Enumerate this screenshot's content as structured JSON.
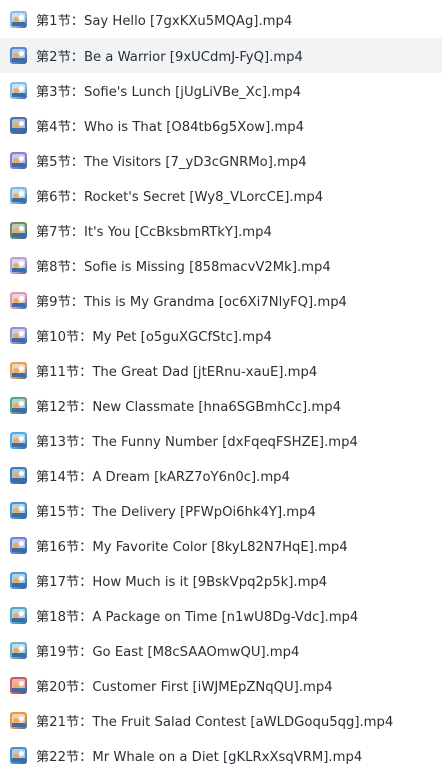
{
  "file_list": {
    "selected_index": 1,
    "items": [
      {
        "name": "第1节：Say Hello [7gxKXu5MQAg].mp4",
        "icon": "video-thumbnail-icon",
        "color": "#8fb7e6"
      },
      {
        "name": "第2节：Be a Warrior [9xUCdmJ-FyQ].mp4",
        "icon": "video-thumbnail-icon",
        "color": "#5f86c9"
      },
      {
        "name": "第3节：Sofie's Lunch [jUgLiVBe_Xc].mp4",
        "icon": "video-thumbnail-icon",
        "color": "#7ec0e8"
      },
      {
        "name": "第4节：Who is That [O84tb6g5Xow].mp4",
        "icon": "video-thumbnail-icon",
        "color": "#4f6fa8"
      },
      {
        "name": "第5节：The Visitors [7_yD3cGNRMo].mp4",
        "icon": "video-thumbnail-icon",
        "color": "#8a7fd6"
      },
      {
        "name": "第6节：Rocket's  Secret [Wy8_VLorcCE].mp4",
        "icon": "video-thumbnail-icon",
        "color": "#7fb6d8"
      },
      {
        "name": "第7节：It's You [CcBksbmRTkY].mp4",
        "icon": "video-thumbnail-icon",
        "color": "#6d8f5e"
      },
      {
        "name": "第8节：Sofie is Missing [858macvV2Mk].mp4",
        "icon": "video-thumbnail-icon",
        "color": "#b7a1d9"
      },
      {
        "name": "第9节：This is My Grandma [oc6Xi7NlyFQ].mp4",
        "icon": "video-thumbnail-icon",
        "color": "#d99ab8"
      },
      {
        "name": "第10节：My Pet [o5guXGCfStc].mp4",
        "icon": "video-thumbnail-icon",
        "color": "#9a8fd4"
      },
      {
        "name": "第11节：The Great Dad [jtERnu-xauE].mp4",
        "icon": "video-thumbnail-icon",
        "color": "#e0a25e"
      },
      {
        "name": "第12节：New Classmate [hna6SGBmhCc].mp4",
        "icon": "video-thumbnail-icon",
        "color": "#5fa08a"
      },
      {
        "name": "第13节：The Funny Number [dxFqeqFSHZE].mp4",
        "icon": "video-thumbnail-icon",
        "color": "#5aa9de"
      },
      {
        "name": "第14节：A Dream [kARZ7oY6n0c].mp4",
        "icon": "video-thumbnail-icon",
        "color": "#3f7fb8"
      },
      {
        "name": "第15节：The Delivery [PFWpOi6hk4Y].mp4",
        "icon": "video-thumbnail-icon",
        "color": "#4e97cf"
      },
      {
        "name": "第16节：My Favorite Color [8kyL82N7HqE].mp4",
        "icon": "video-thumbnail-icon",
        "color": "#6a86d2"
      },
      {
        "name": "第17节：How Much is it [9BskVpq2p5k].mp4",
        "icon": "video-thumbnail-icon",
        "color": "#4f9bd6"
      },
      {
        "name": "第18节：A Package on Time [n1wU8Dg-Vdc].mp4",
        "icon": "video-thumbnail-icon",
        "color": "#5fa7c8"
      },
      {
        "name": "第19节：Go East [M8cSAAOmwQU].mp4",
        "icon": "video-thumbnail-icon",
        "color": "#6cb3c4"
      },
      {
        "name": "第20节：Customer First [iWJMEpZNqQU].mp4",
        "icon": "video-thumbnail-icon",
        "color": "#d25a5a"
      },
      {
        "name": "第21节：The Fruit Salad Contest [aWLDGoqu5qg].mp4",
        "icon": "video-thumbnail-icon",
        "color": "#e39a4a"
      },
      {
        "name": "第22节：Mr Whale on a Diet [gKLRxXsqVRM].mp4",
        "icon": "video-thumbnail-icon",
        "color": "#4a92cf"
      }
    ]
  }
}
